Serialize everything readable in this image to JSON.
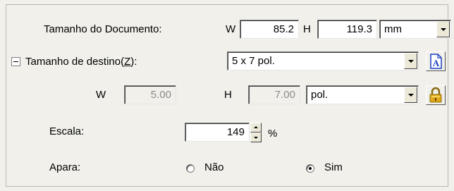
{
  "document_size": {
    "label": "Tamanho do Documento:",
    "w_label": "W",
    "w_value": "85.2",
    "h_label": "H",
    "h_value": "119.3",
    "unit": "mm"
  },
  "target_size": {
    "label_prefix": "Tamanho de destino(",
    "label_key": "Z",
    "label_suffix": "):",
    "selected": "5 x 7 pol.",
    "w_label": "W",
    "w_value": "5.00",
    "h_label": "H",
    "h_value": "7.00",
    "unit": "pol."
  },
  "scale": {
    "label": "Escala:",
    "value": "149",
    "unit": "%"
  },
  "trim": {
    "label": "Apara:",
    "options": [
      {
        "label": "Não",
        "checked": false
      },
      {
        "label": "Sim",
        "checked": true
      }
    ]
  },
  "icons": {
    "orientation": "portrait-document-icon",
    "lock": "lock-icon"
  },
  "colors": {
    "background": "#f1f0eb",
    "icon_blue": "#1a3fc4",
    "lock_gold": "#e0a817"
  }
}
